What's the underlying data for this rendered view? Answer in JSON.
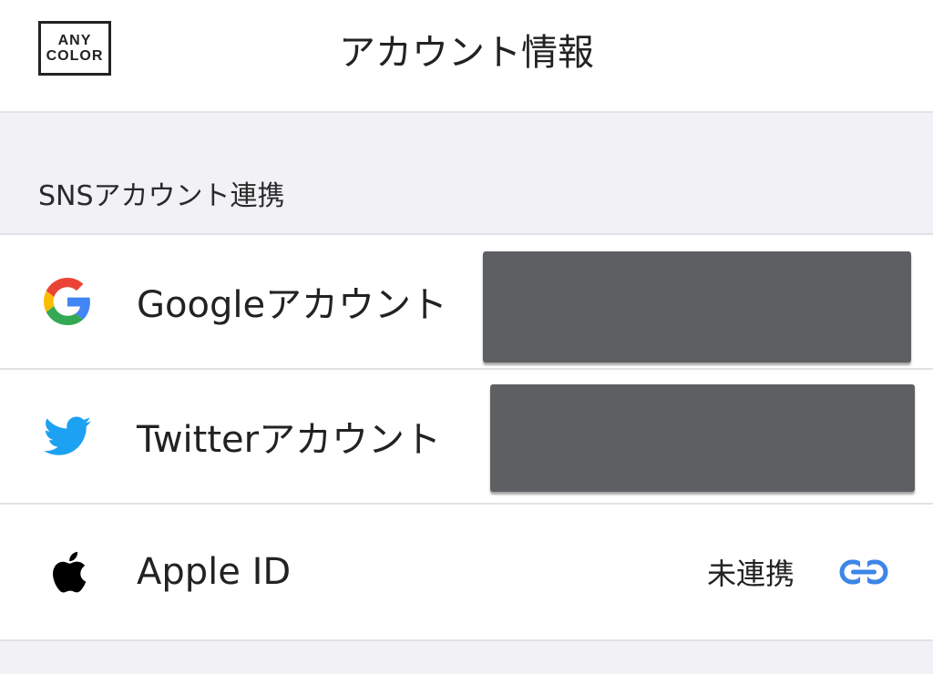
{
  "header": {
    "logo_line1": "ANY",
    "logo_line2": "COLOR",
    "title": "アカウント情報"
  },
  "section": {
    "label": "SNSアカウント連携"
  },
  "accounts": [
    {
      "icon": "google-icon",
      "label": "Googleアカウント",
      "status": "",
      "redacted": true
    },
    {
      "icon": "twitter-icon",
      "label": "Twitterアカウント",
      "status": "",
      "redacted": true
    },
    {
      "icon": "apple-icon",
      "label": "Apple ID",
      "status": "未連携",
      "action_icon": "link-icon"
    }
  ],
  "colors": {
    "twitter_blue": "#1DA1F2",
    "link_blue": "#3d86e8",
    "google_blue": "#4285F4",
    "google_red": "#EA4335",
    "google_yellow": "#FBBC05",
    "google_green": "#34A853"
  }
}
